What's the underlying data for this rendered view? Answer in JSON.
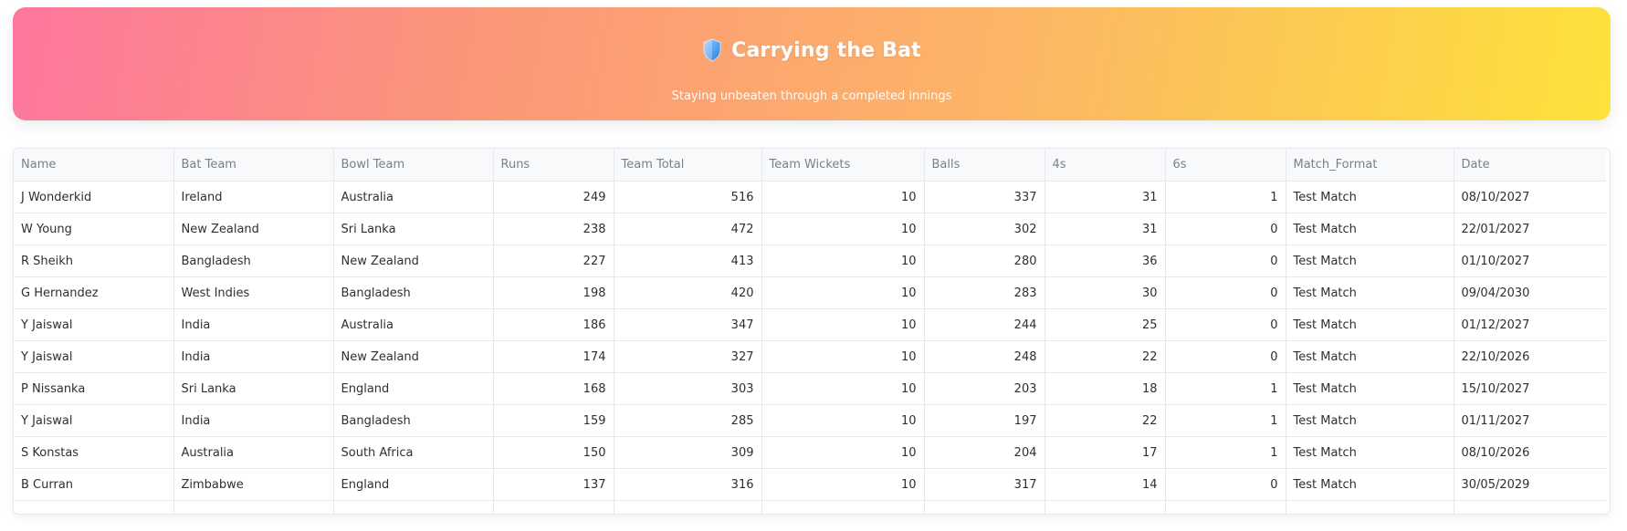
{
  "banner": {
    "icon": "shield-icon",
    "title": "Carrying the Bat",
    "subtitle": "Staying unbeaten through a completed innings",
    "colors": {
      "gradient_start": "#fd779d",
      "gradient_mid": "#fcb566",
      "gradient_end": "#fde23b"
    }
  },
  "table": {
    "columns": [
      "Name",
      "Bat Team",
      "Bowl Team",
      "Runs",
      "Team Total",
      "Team Wickets",
      "Balls",
      "4s",
      "6s",
      "Match_Format",
      "Date"
    ],
    "rows": [
      [
        "J Wonderkid",
        "Ireland",
        "Australia",
        "249",
        "516",
        "10",
        "337",
        "31",
        "1",
        "Test Match",
        "08/10/2027"
      ],
      [
        "W Young",
        "New Zealand",
        "Sri Lanka",
        "238",
        "472",
        "10",
        "302",
        "31",
        "0",
        "Test Match",
        "22/01/2027"
      ],
      [
        "R Sheikh",
        "Bangladesh",
        "New Zealand",
        "227",
        "413",
        "10",
        "280",
        "36",
        "0",
        "Test Match",
        "01/10/2027"
      ],
      [
        "G Hernandez",
        "West Indies",
        "Bangladesh",
        "198",
        "420",
        "10",
        "283",
        "30",
        "0",
        "Test Match",
        "09/04/2030"
      ],
      [
        "Y Jaiswal",
        "India",
        "Australia",
        "186",
        "347",
        "10",
        "244",
        "25",
        "0",
        "Test Match",
        "01/12/2027"
      ],
      [
        "Y Jaiswal",
        "India",
        "New Zealand",
        "174",
        "327",
        "10",
        "248",
        "22",
        "0",
        "Test Match",
        "22/10/2026"
      ],
      [
        "P Nissanka",
        "Sri Lanka",
        "England",
        "168",
        "303",
        "10",
        "203",
        "18",
        "1",
        "Test Match",
        "15/10/2027"
      ],
      [
        "Y Jaiswal",
        "India",
        "Bangladesh",
        "159",
        "285",
        "10",
        "197",
        "22",
        "1",
        "Test Match",
        "01/11/2027"
      ],
      [
        "S Konstas",
        "Australia",
        "South Africa",
        "150",
        "309",
        "10",
        "204",
        "17",
        "1",
        "Test Match",
        "08/10/2026"
      ],
      [
        "B Curran",
        "Zimbabwe",
        "England",
        "137",
        "316",
        "10",
        "317",
        "14",
        "0",
        "Test Match",
        "30/05/2029"
      ]
    ]
  }
}
